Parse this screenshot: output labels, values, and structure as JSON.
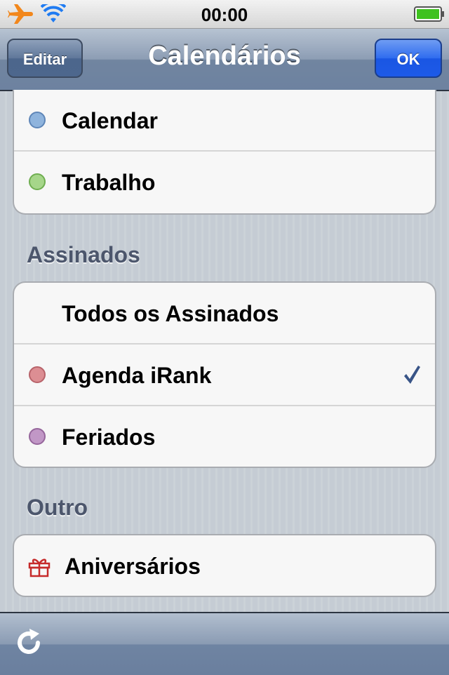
{
  "status_bar": {
    "time": "00:00",
    "icons": [
      "airplane-icon",
      "wifi-icon",
      "battery-icon"
    ],
    "battery_color": "#3ec21f"
  },
  "nav": {
    "edit_label": "Editar",
    "title": "Calendários",
    "ok_label": "OK"
  },
  "groups": {
    "local": {
      "items": [
        {
          "label": "Calendar",
          "color": "#8fb4dd"
        },
        {
          "label": "Trabalho",
          "color": "#a6d68a"
        }
      ]
    },
    "subscribed": {
      "header": "Assinados",
      "items": [
        {
          "label": "Todos os Assinados"
        },
        {
          "label": "Agenda iRank",
          "color": "#dc8e93",
          "checked": true
        },
        {
          "label": "Feriados",
          "color": "#c197c6"
        }
      ]
    },
    "other": {
      "header": "Outro",
      "items": [
        {
          "label": "Aniversários",
          "icon": "gift-icon"
        }
      ]
    }
  },
  "toolbar": {
    "refresh_icon": "refresh-icon"
  }
}
